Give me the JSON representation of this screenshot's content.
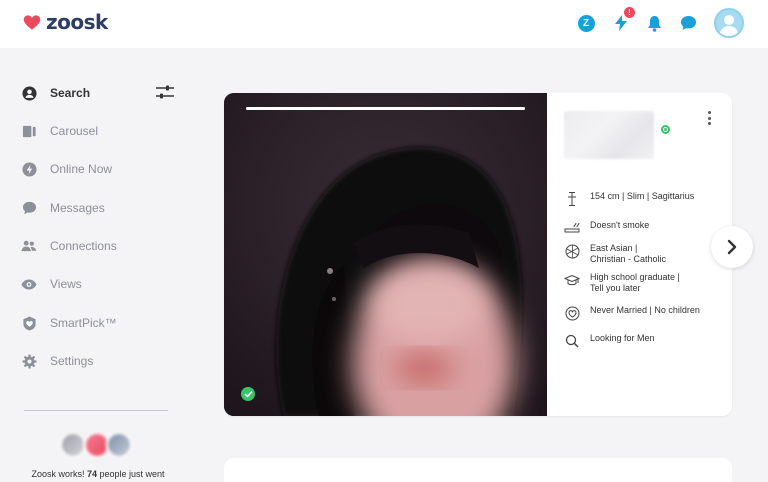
{
  "brand": {
    "name": "zoosk",
    "heart_color": "#e94b5c",
    "text_color": "#2c3e66"
  },
  "header": {
    "coin_label": "Z",
    "boost_badge": "!",
    "accent_color": "#1a9fd9",
    "icons": [
      "zoosk-coin-icon",
      "boost-icon",
      "bell-icon",
      "chat-icon",
      "avatar"
    ]
  },
  "sidebar": {
    "items": [
      {
        "label": "Search",
        "icon": "person-icon",
        "active": true
      },
      {
        "label": "Carousel",
        "icon": "carousel-icon",
        "active": false
      },
      {
        "label": "Online Now",
        "icon": "lightning-icon",
        "active": false
      },
      {
        "label": "Messages",
        "icon": "message-icon",
        "active": false
      },
      {
        "label": "Connections",
        "icon": "people-icon",
        "active": false
      },
      {
        "label": "Views",
        "icon": "eye-icon",
        "active": false
      },
      {
        "label": "SmartPick™",
        "icon": "smartpick-icon",
        "active": false
      },
      {
        "label": "Settings",
        "icon": "gear-icon",
        "active": false
      }
    ],
    "promo_prefix": "Zoosk works! ",
    "promo_count": "74",
    "promo_suffix": " people just went"
  },
  "profile": {
    "photo_progress": 1.0,
    "verified": true,
    "online": true,
    "attributes": [
      {
        "icon": "height-icon",
        "lines": [
          "154 cm | Slim | Sagittarius"
        ]
      },
      {
        "icon": "smoking-icon",
        "lines": [
          "Doesn't smoke"
        ]
      },
      {
        "icon": "globe-icon",
        "lines": [
          "East Asian |",
          "Christian - Catholic"
        ]
      },
      {
        "icon": "graduation-cap-icon",
        "lines": [
          "High school graduate |",
          "Tell you later"
        ]
      },
      {
        "icon": "heart-outline-icon",
        "lines": [
          "Never Married | No children"
        ]
      },
      {
        "icon": "search-icon",
        "lines": [
          "Looking for Men"
        ]
      }
    ]
  }
}
